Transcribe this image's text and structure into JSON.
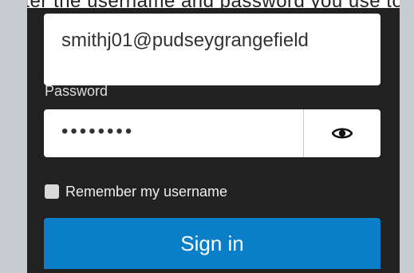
{
  "header": {
    "instruction_text": "Enter the username and password you use to log in to your school network."
  },
  "login": {
    "username_value": "smithj01@pudseygrangefield",
    "password_label": "Password",
    "password_value": "••••••••",
    "show_password_icon": "eye-icon",
    "remember_label": "Remember my username",
    "remember_checked": false,
    "signin_label": "Sign in"
  },
  "colors": {
    "panel_bg": "#212121",
    "side_bg": "#c4ccd1",
    "primary_button": "#0a7fc7"
  }
}
